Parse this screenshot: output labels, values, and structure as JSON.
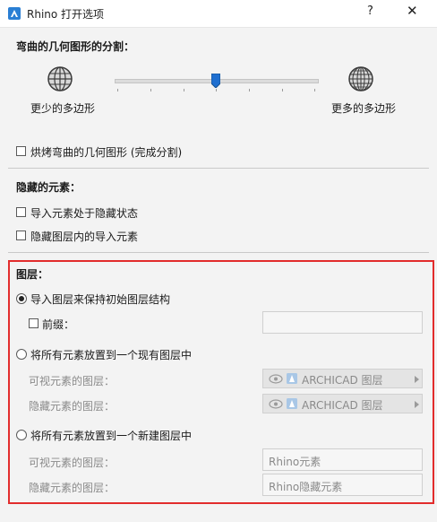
{
  "window": {
    "title": "Rhino 打开选项",
    "help_label": "?",
    "close_label": "✕"
  },
  "tessellation": {
    "heading": "弯曲的几何图形的分割：",
    "less_label": "更少的多边形",
    "more_label": "更多的多边形",
    "slider_fraction": 0.5,
    "bake_label": "烘烤弯曲的几何图形 (完成分割)",
    "bake_checked": false
  },
  "hidden": {
    "heading": "隐藏的元素：",
    "import_hidden_label": "导入元素处于隐藏状态",
    "import_hidden_checked": false,
    "hide_in_layers_label": "隐藏图层内的导入元素",
    "hide_in_layers_checked": false
  },
  "layers": {
    "heading": "图层：",
    "option1_label": "导入图层来保持初始图层结构",
    "option1_selected": true,
    "prefix_label": "前缀：",
    "prefix_checked": false,
    "prefix_value": "",
    "option2_label": "将所有元素放置到一个现有图层中",
    "option2_selected": false,
    "visible_layer_label": "可视元素的图层：",
    "hidden_layer_label": "隐藏元素的图层：",
    "existing_visible_value": "ARCHICAD 图层",
    "existing_hidden_value": "ARCHICAD 图层",
    "option3_label": "将所有元素放置到一个新建图层中",
    "option3_selected": false,
    "new_visible_label": "可视元素的图层：",
    "new_hidden_label": "隐藏元素的图层：",
    "new_visible_value": "Rhino元素",
    "new_hidden_value": "Rhino隐藏元素"
  },
  "colors": {
    "highlight_border": "#e22c2c",
    "slider_thumb": "#1f6fd0",
    "app_icon": "#2a7fd4"
  }
}
